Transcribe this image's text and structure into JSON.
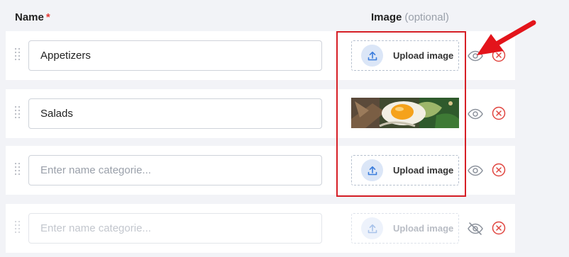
{
  "header": {
    "name_label": "Name",
    "required_mark": "*",
    "image_label": "Image",
    "optional_label": "(optional)"
  },
  "rows": [
    {
      "name_value": "Appetizers",
      "placeholder": "Enter name categorie...",
      "has_image": false,
      "upload_label": "Upload image",
      "visible": true,
      "enabled": true
    },
    {
      "name_value": "Salads",
      "placeholder": "Enter name categorie...",
      "has_image": true,
      "upload_label": "Upload image",
      "visible": true,
      "enabled": true
    },
    {
      "name_value": "",
      "placeholder": "Enter name categorie...",
      "has_image": false,
      "upload_label": "Upload image",
      "visible": true,
      "enabled": true
    },
    {
      "name_value": "",
      "placeholder": "Enter name categorie...",
      "has_image": false,
      "upload_label": "Upload image",
      "visible": false,
      "enabled": false
    }
  ],
  "icons": {
    "drag": "drag-handle-icon",
    "upload": "upload-icon",
    "visible": "eye-icon",
    "hidden": "eye-off-icon",
    "delete": "remove-circle-icon"
  },
  "colors": {
    "required": "#e53935",
    "accent": "#3b7ddd",
    "delete": "#e0453f",
    "highlight": "#d61f26"
  }
}
